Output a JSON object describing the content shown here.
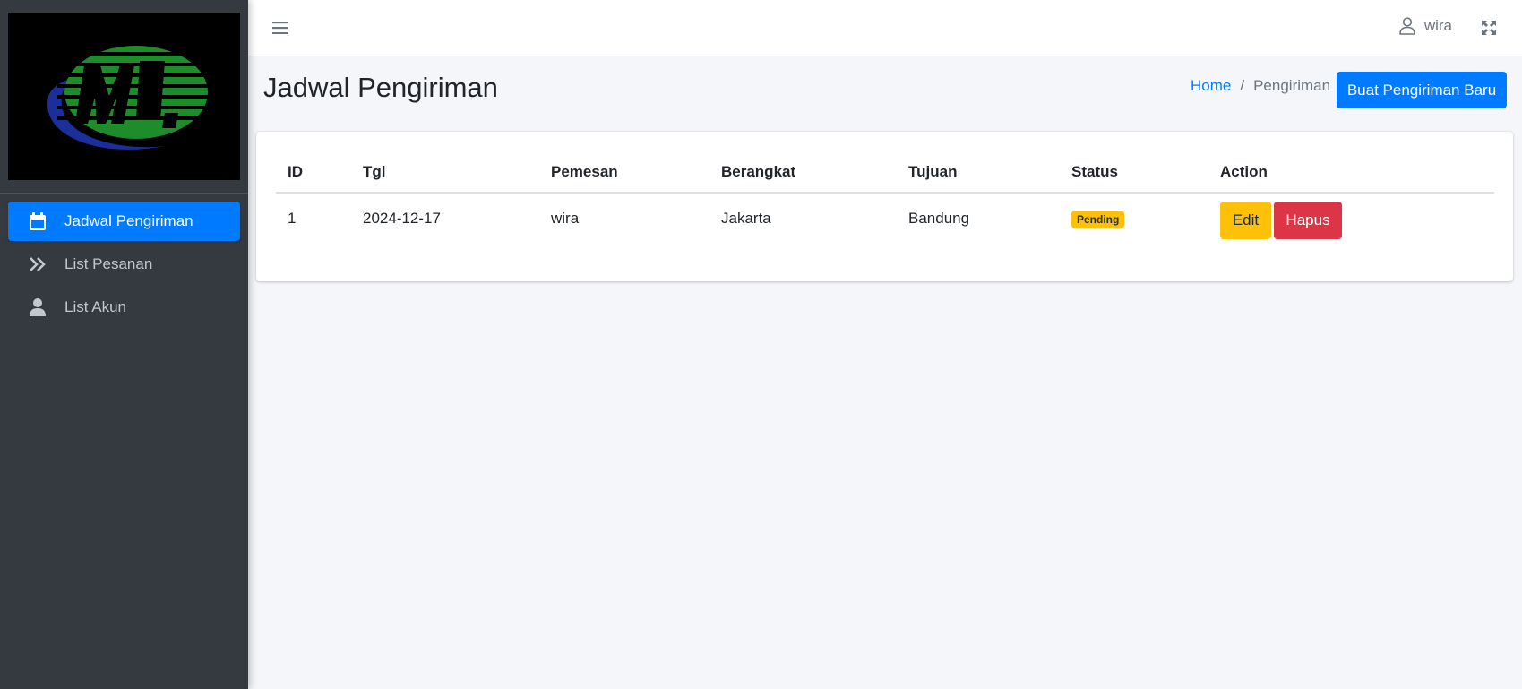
{
  "sidebar": {
    "items": [
      {
        "label": "Jadwal Pengiriman",
        "icon": "calendar-icon",
        "active": true
      },
      {
        "label": "List Pesanan",
        "icon": "angle-double-right-icon",
        "active": false
      },
      {
        "label": "List Akun",
        "icon": "user-icon",
        "active": false
      }
    ]
  },
  "topbar": {
    "menu_icon": "hamburger-icon",
    "username": "wira",
    "user_icon": "user-outline-icon",
    "expand_icon": "fullscreen-icon"
  },
  "header": {
    "title": "Jadwal Pengiriman",
    "breadcrumb": {
      "home": "Home",
      "separator": "/",
      "current": "Pengiriman"
    },
    "new_button": "Buat Pengiriman Baru"
  },
  "table": {
    "columns": [
      "ID",
      "Tgl",
      "Pemesan",
      "Berangkat",
      "Tujuan",
      "Status",
      "Action"
    ],
    "rows": [
      {
        "id": "1",
        "tgl": "2024-12-17",
        "pemesan": "wira",
        "berangkat": "Jakarta",
        "tujuan": "Bandung",
        "status": "Pending",
        "edit_label": "Edit",
        "delete_label": "Hapus"
      }
    ]
  },
  "colors": {
    "primary": "#007bff",
    "warning": "#ffc107",
    "danger": "#dc3545",
    "sidebar_bg": "#343a40",
    "logo_green": "#1e8c2a",
    "logo_blue": "#1a2e9c"
  }
}
